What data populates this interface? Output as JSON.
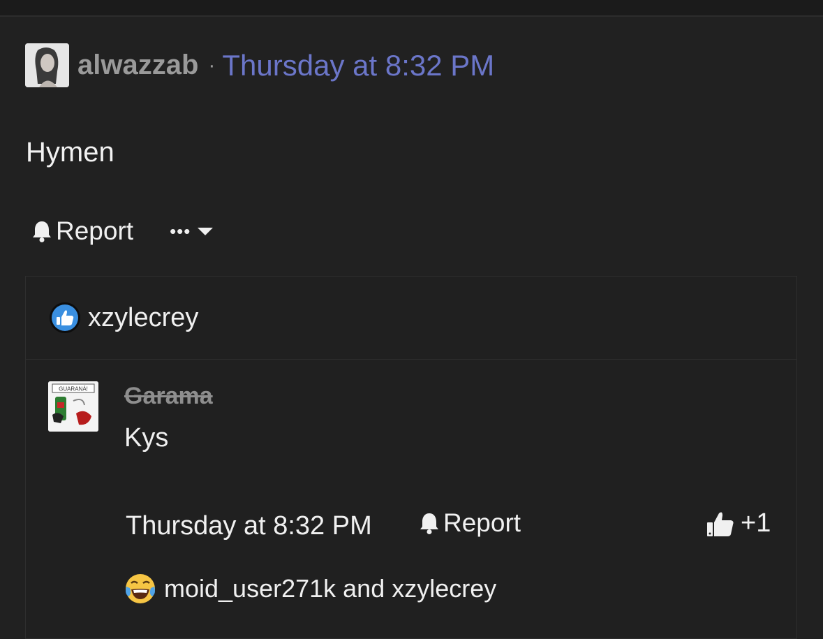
{
  "post": {
    "author": "alwazzab",
    "separator": "·",
    "time": "Thursday at 8:32 PM",
    "body": "Hymen",
    "actions": {
      "report_label": "Report",
      "more_label": "•••"
    }
  },
  "reactions": {
    "icon": "like-icon",
    "users": "xzylecrey"
  },
  "comment": {
    "author": "Garama",
    "avatar_text": "GUARANÁ!",
    "body": "Kys",
    "time": "Thursday at 8:32 PM",
    "report_label": "Report",
    "like_count": "+1",
    "reaction_icon": "laugh-cry-icon",
    "reaction_users": "moid_user271k and xzylecrey"
  },
  "colors": {
    "background": "#212121",
    "timestamp": "#6b76c9",
    "author": "#9a9a9a",
    "like_badge": "#3a8fe0"
  }
}
